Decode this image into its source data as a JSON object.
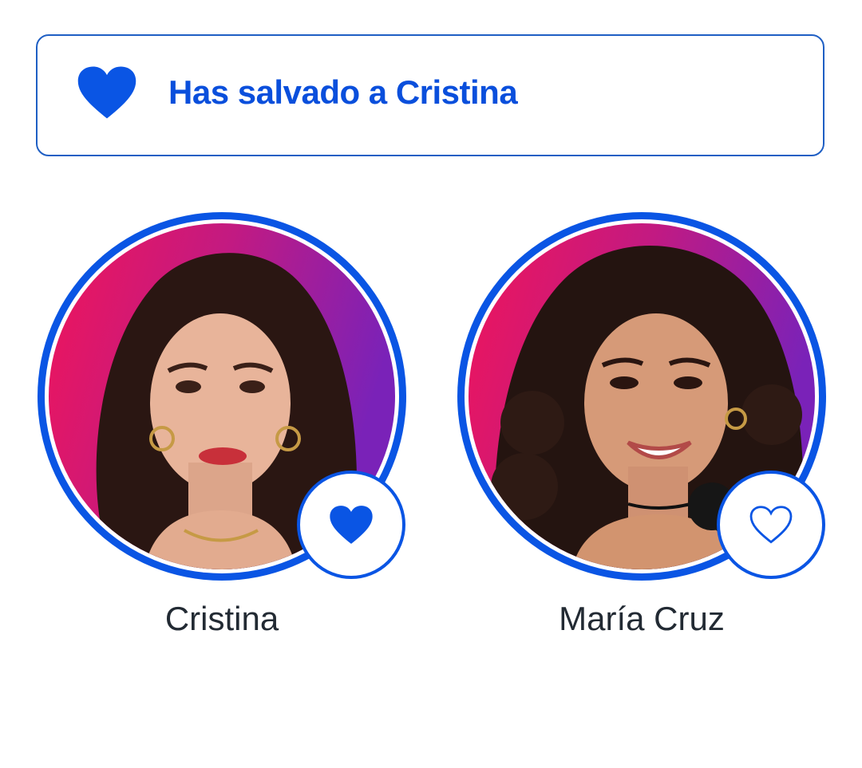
{
  "banner": {
    "message": "Has salvado a Cristina",
    "icon": "heart-filled-icon",
    "accent_color": "#0a55e4"
  },
  "contestants": [
    {
      "name": "Cristina",
      "selected": true,
      "vote_icon": "heart-filled-icon"
    },
    {
      "name": "María Cruz",
      "selected": false,
      "vote_icon": "heart-outline-icon"
    }
  ]
}
